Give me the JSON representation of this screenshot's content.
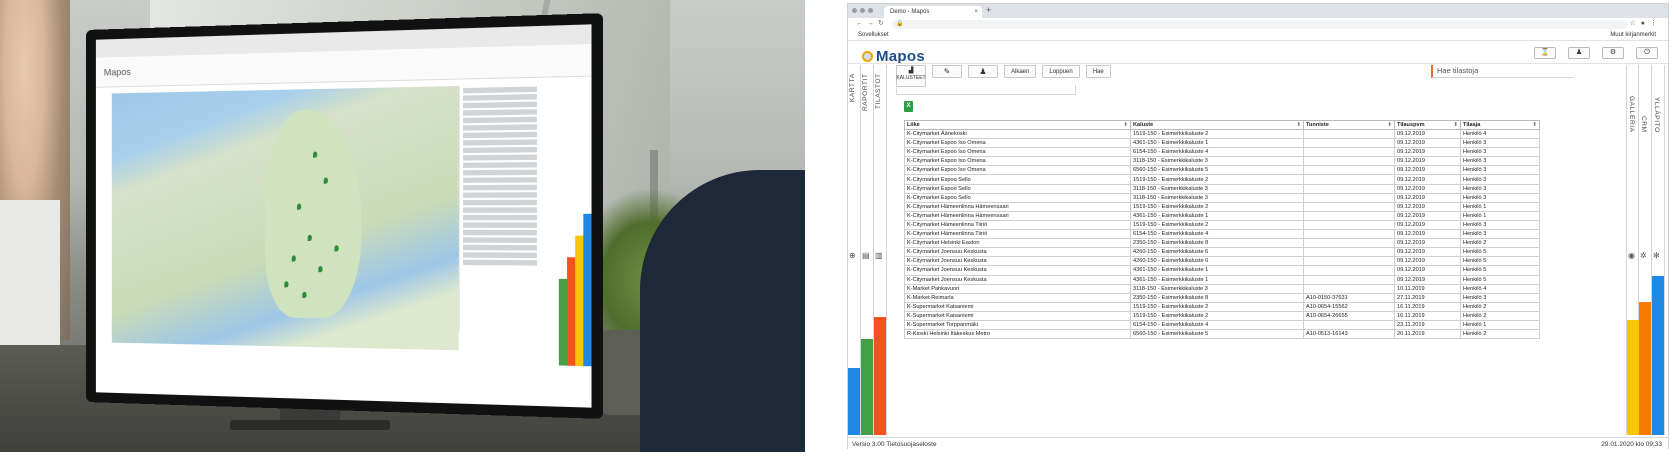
{
  "browser": {
    "tab_title": "Demo - Mapos",
    "tab_close": "×",
    "new_tab": "+",
    "bookmark_apps": "Sovellukset",
    "bookmark_other": "Muut kirjanmerkit"
  },
  "app": {
    "logo_text": "Mapos",
    "left_sidebar": [
      "KARTTA",
      "RAPORTIT",
      "TILASTOT"
    ],
    "right_sidebar": [
      "GALLERIA",
      "CRM",
      "YLLÄPITO"
    ],
    "toolbar": {
      "active_label": "KALUSTEET",
      "alkaen": "Alkaen",
      "loppuen": "Loppuen",
      "hae": "Hae"
    },
    "search_placeholder": "Hae tilastoja",
    "excel_icon": "excel-icon",
    "table": {
      "headers": [
        "Liike",
        "Kaluste",
        "Tunniste",
        "Tilauspvm",
        "Tilaaja"
      ],
      "sort_glyph": "⬍",
      "rows": [
        [
          "K-Citymarket Äänekoski",
          "1519-150 - Esimerkkikaluste 2",
          "",
          "09.12.2019",
          "Henkilö 4"
        ],
        [
          "K-Citymarket Espoo Iso Omena",
          "4361-150 - Esimerkkikaluste 1",
          "",
          "09.12.2019",
          "Henkilö 3"
        ],
        [
          "K-Citymarket Espoo Iso Omena",
          "6154-150 - Esimerkkikaluste 4",
          "",
          "09.12.2019",
          "Henkilö 3"
        ],
        [
          "K-Citymarket Espoo Iso Omena",
          "3118-150 - Esimerkkikaluste 3",
          "",
          "09.12.2019",
          "Henkilö 3"
        ],
        [
          "K-Citymarket Espoo Iso Omena",
          "6560-150 - Esimerkkikaluste 5",
          "",
          "09.12.2019",
          "Henkilö 3"
        ],
        [
          "K-Citymarket Espoo Sello",
          "1519-150 - Esimerkkikaluste 2",
          "",
          "09.12.2019",
          "Henkilö 3"
        ],
        [
          "K-Citymarket Espoo Sello",
          "3118-150 - Esimerkkikaluste 3",
          "",
          "09.12.2019",
          "Henkilö 3"
        ],
        [
          "K-Citymarket Espoo Sello",
          "3118-150 - Esimerkkikaluste 3",
          "",
          "09.12.2019",
          "Henkilö 3"
        ],
        [
          "K-Citymarket Hämeenlinna Hämeensaari",
          "1519-150 - Esimerkkikaluste 2",
          "",
          "09.12.2019",
          "Henkilö 1"
        ],
        [
          "K-Citymarket Hämeenlinna Hämeensaari",
          "4361-150 - Esimerkkikaluste 1",
          "",
          "09.12.2019",
          "Henkilö 1"
        ],
        [
          "K-Citymarket Hämeenlinna Tiiriö",
          "1519-150 - Esimerkkikaluste 2",
          "",
          "09.12.2019",
          "Henkilö 3"
        ],
        [
          "K-Citymarket Hämeenlinna Tiiriö",
          "6154-150 - Esimerkkikaluste 4",
          "",
          "09.12.2019",
          "Henkilö 3"
        ],
        [
          "K-Citymarket Helsinki Easton",
          "2350-150 - Esimerkkikaluste 8",
          "",
          "09.12.2019",
          "Henkilö 2"
        ],
        [
          "K-Citymarket Joensuu Keskusta",
          "4260-150 - Esimerkkikaluste 6",
          "",
          "09.12.2019",
          "Henkilö 5"
        ],
        [
          "K-Citymarket Joensuu Keskusta",
          "4260-150 - Esimerkkikaluste 6",
          "",
          "09.12.2019",
          "Henkilö 5"
        ],
        [
          "K-Citymarket Joensuu Keskusta",
          "4361-150 - Esimerkkikaluste 1",
          "",
          "09.12.2019",
          "Henkilö 5"
        ],
        [
          "K-Citymarket Joensuu Keskusta",
          "4361-150 - Esimerkkikaluste 1",
          "",
          "09.12.2019",
          "Henkilö 5"
        ],
        [
          "K-Market Pahkavuori",
          "3118-150 - Esimerkkikaluste 3",
          "",
          "10.11.2019",
          "Henkilö 4"
        ],
        [
          "K-Market Reimarla",
          "2350-150 - Esimerkkikaluste 8",
          "A10-0150-37631",
          "27.11.2019",
          "Henkilö 3"
        ],
        [
          "K-Supermarket Kaisaniemi",
          "1519-150 - Esimerkkikaluste 2",
          "A10-0654-15562",
          "16.11.2019",
          "Henkilö 2"
        ],
        [
          "K-Supermarket Kaisaniemi",
          "1519-150 - Esimerkkikaluste 2",
          "A10-0654-26655",
          "16.11.2019",
          "Henkilö 2"
        ],
        [
          "K-Supermarket Torppanmäki",
          "6154-150 - Esimerkkikaluste 4",
          "",
          "23.11.2019",
          "Henkilö 1"
        ],
        [
          "R-Kioski Helsinki Itäkeskus Metro",
          "6560-150 - Esimerkkikaluste 5",
          "A10-0513-16143",
          "20.11.2019",
          "Henkilö 2"
        ]
      ]
    },
    "status": {
      "version": "Versio 3.00  Tietosuojaseloste",
      "datetime": "29.01.2020 klo 09:33"
    },
    "gauges": {
      "left": [
        {
          "color": "#1e88e5",
          "level": 0.18
        },
        {
          "color": "#43a047",
          "level": 0.26
        },
        {
          "color": "#f4511e",
          "level": 0.32
        }
      ],
      "right": [
        {
          "color": "#f9c400",
          "level": 0.31
        },
        {
          "color": "#f57c00",
          "level": 0.36
        },
        {
          "color": "#1e88e5",
          "level": 0.43
        }
      ]
    }
  },
  "photo": {
    "screen_header": "Mapos"
  }
}
